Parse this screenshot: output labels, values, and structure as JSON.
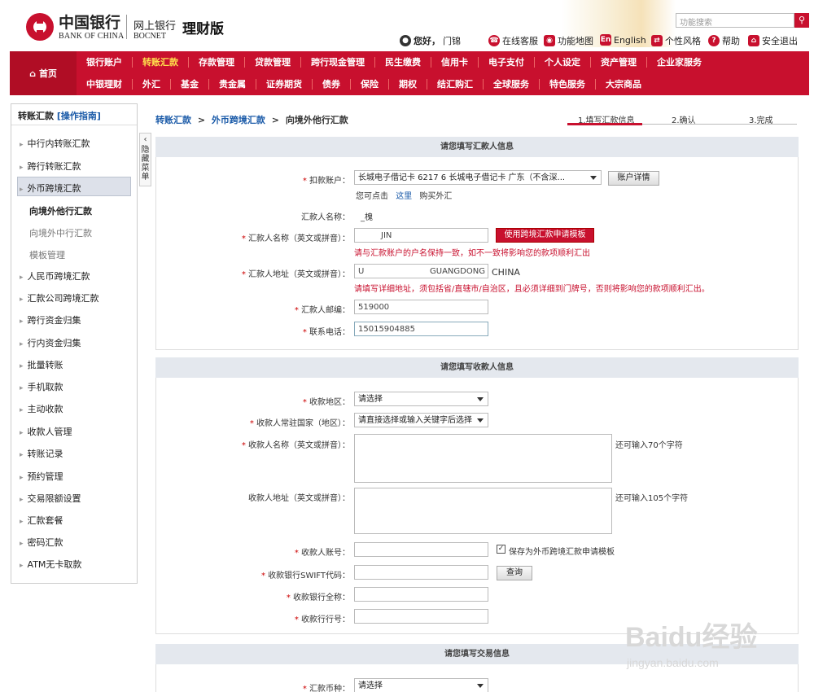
{
  "header": {
    "logo_cn": "中国银行",
    "logo_en": "BANK OF CHINA",
    "ebank_cn": "网上银行",
    "ebank_en": "BOCNET",
    "version": "理财版",
    "search_placeholder": "功能搜索",
    "greeting": "您好，",
    "user_name": "门锦",
    "toolbar": [
      "在线客服",
      "功能地图",
      "English",
      "个性风格",
      "帮助",
      "安全退出"
    ]
  },
  "nav": {
    "home": "首页",
    "row1": [
      "银行账户",
      "转账汇款",
      "存款管理",
      "贷款管理",
      "跨行现金管理",
      "民生缴费",
      "信用卡",
      "电子支付",
      "个人设定",
      "资产管理",
      "企业家服务"
    ],
    "row2": [
      "中银理财",
      "外汇",
      "基金",
      "贵金属",
      "证券期货",
      "债券",
      "保险",
      "期权",
      "结汇购汇",
      "全球服务",
      "特色服务",
      "大宗商品"
    ]
  },
  "sidebar": {
    "title": "转账汇款",
    "guide": "[操作指南]",
    "items": [
      "中行内转账汇款",
      "跨行转账汇款",
      "外币跨境汇款",
      "人民币跨境汇款",
      "汇款公司跨境汇款",
      "跨行资金归集",
      "行内资金归集",
      "批量转账",
      "手机取款",
      "主动收款",
      "收款人管理",
      "转账记录",
      "预约管理",
      "交易限额设置",
      "汇款套餐",
      "密码汇款",
      "ATM无卡取款"
    ],
    "subitems": [
      "向境外他行汇款",
      "向境外中行汇款",
      "模板管理"
    ],
    "collapse_label": "隐藏菜单"
  },
  "breadcrumb": {
    "a": "转账汇款",
    "b": "外币跨境汇款",
    "c": "向境外他行汇款",
    "sep": ">"
  },
  "steps": [
    "1.填写汇款信息",
    "2.确认",
    "3.完成"
  ],
  "remitter": {
    "heading": "请您填写汇款人信息",
    "account_label": "扣款账户：",
    "account_value": "长城电子借记卡 6217        6 长城电子借记卡 广东（不含深...",
    "account_detail_btn": "账户详情",
    "click_hint": "您可点击",
    "here": "这里",
    "buy_fx": "购买外汇",
    "name_label": "汇款人名称：",
    "name_value": "_槐",
    "en_name_label": "汇款人名称（英文或拼音）：",
    "en_name_value": "JIN",
    "template_btn": "使用跨境汇款申请模板",
    "en_name_hint": "请与汇款账户的户名保持一致，如不一致将影响您的款项顺利汇出",
    "address_label": "汇款人地址（英文或拼音）：",
    "address_value1": "U",
    "address_value2": "GUANGDONG",
    "address_country": "CHINA",
    "address_hint": "请填写详细地址，须包括省/直辖市/自治区，且必须详细到门牌号，否则将影响您的款项顺利汇出。",
    "zip_label": "汇款人邮编：",
    "zip_value": "519000",
    "phone_label": "联系电话：",
    "phone_value": "15015904885"
  },
  "payee": {
    "heading": "请您填写收款人信息",
    "region_label": "收款地区：",
    "region_value": "请选择",
    "country_label": "收款人常驻国家（地区）：",
    "country_value": "请直接选择或输入关键字后选择",
    "name_label": "收款人名称（英文或拼音）：",
    "name_hint": "还可输入70个字符",
    "address_label": "收款人地址（英文或拼音）：",
    "address_hint": "还可输入105个字符",
    "account_label": "收款人账号：",
    "save_template": "保存为外币跨境汇款申请模板",
    "swift_label": "收款银行SWIFT代码：",
    "query_btn": "查询",
    "bank_name_label": "收款银行全称：",
    "bank_no_label": "收款行行号："
  },
  "transaction": {
    "heading": "请您填写交易信息",
    "currency_label": "汇款币种：",
    "currency_value": "请选择"
  },
  "watermark": {
    "brand": "Baidu经验",
    "url": "jingyan.baidu.com"
  },
  "colors": {
    "brand_red": "#c8102e",
    "link_blue": "#1a5aa8",
    "nav_active": "#ffe14d"
  }
}
